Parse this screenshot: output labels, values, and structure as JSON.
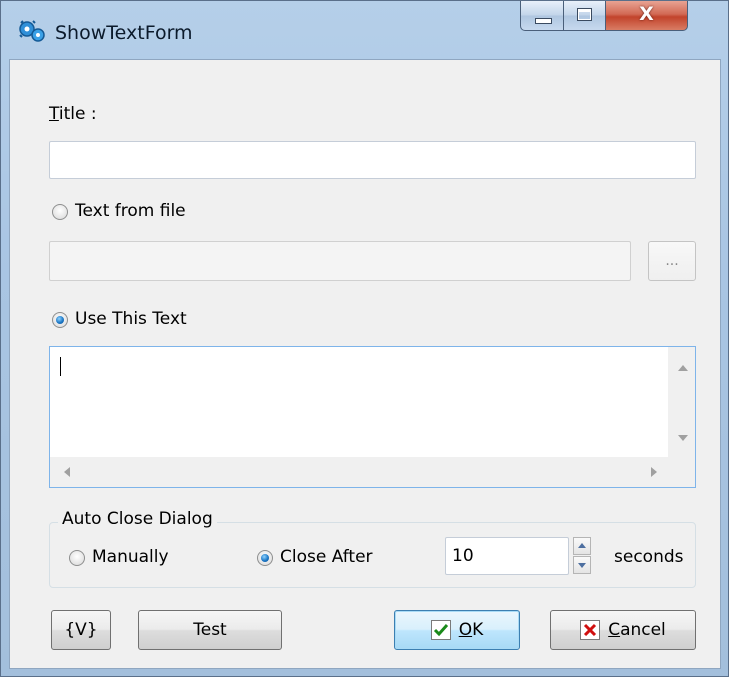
{
  "window": {
    "title": "ShowTextForm",
    "close_glyph": "X",
    "icon": "app-gears-icon"
  },
  "form": {
    "title_label_prefix": "T",
    "title_label_rest": "itle :",
    "title_value": "",
    "text_from_file_label": "Text from file",
    "text_from_file_checked": false,
    "file_path_value": "",
    "browse_label": "...",
    "use_this_text_label": "Use This Text",
    "use_this_text_checked": true,
    "text_value": ""
  },
  "auto_close": {
    "group_title": "Auto Close Dialog",
    "manually_label": "Manually",
    "manually_checked": false,
    "close_after_label": "Close After",
    "close_after_checked": true,
    "seconds_value": "10",
    "seconds_label": "seconds"
  },
  "buttons": {
    "variables_label": "{V}",
    "test_label": "Test",
    "ok_underline": "O",
    "ok_rest": "K",
    "cancel_underline": "C",
    "cancel_rest": "ancel"
  },
  "colors": {
    "ok_check": "#1a8a1a",
    "cancel_x": "#d01010",
    "accent_border": "#7eb4ea"
  }
}
